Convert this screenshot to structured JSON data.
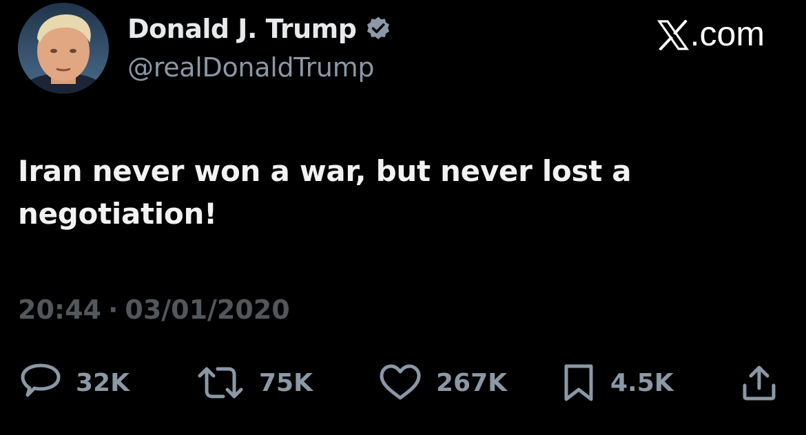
{
  "author": {
    "display_name": "Donald J. Trump",
    "handle": "@realDonaldTrump",
    "verified": true,
    "verified_color": "#8b98a5"
  },
  "brand": {
    "mark": "X",
    "suffix": ".com"
  },
  "tweet": {
    "text": "Iran never won a war, but never lost a negotiation!"
  },
  "meta": {
    "time": "20:44",
    "separator": "·",
    "date": "03/01/2020"
  },
  "actions": {
    "reply": {
      "icon": "reply-icon",
      "count": "32K"
    },
    "repost": {
      "icon": "repost-icon",
      "count": "75K"
    },
    "like": {
      "icon": "heart-icon",
      "count": "267K"
    },
    "bookmark": {
      "icon": "bookmark-icon",
      "count": "4.5K"
    },
    "share": {
      "icon": "share-icon"
    }
  },
  "colors": {
    "background": "#000000",
    "primary_text": "#e7e9ea",
    "secondary_text": "#8b98a5",
    "timestamp_text": "#52575c"
  }
}
